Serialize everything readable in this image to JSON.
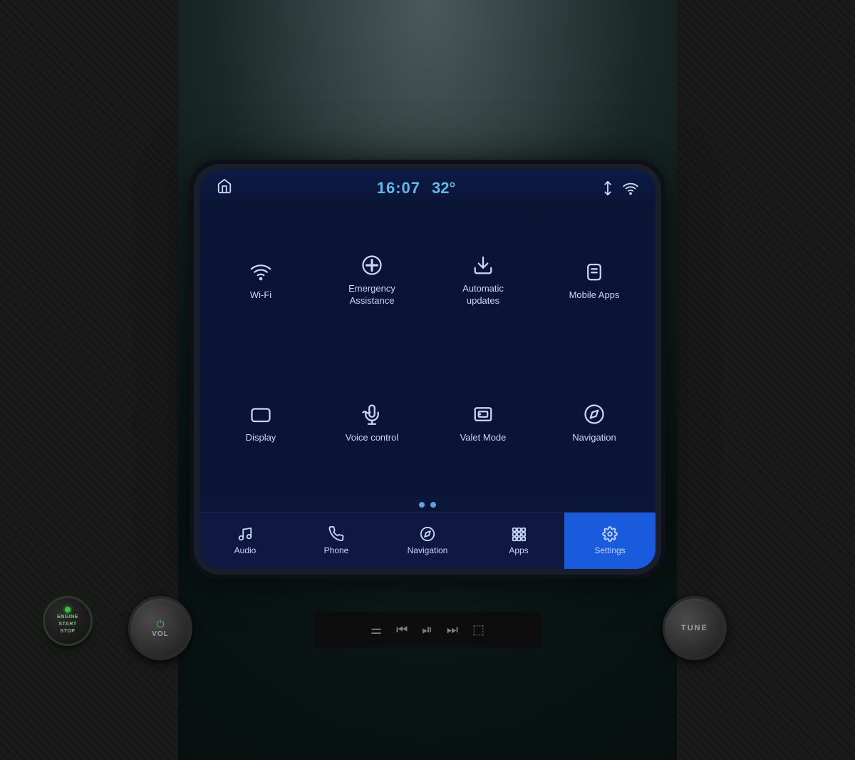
{
  "header": {
    "home_icon": "⌂",
    "time": "16:07",
    "temp": "32°",
    "signal_icon": "↕",
    "wifi_icon": "wifi"
  },
  "grid": {
    "items": [
      {
        "id": "wifi",
        "label": "Wi-Fi",
        "icon": "wifi"
      },
      {
        "id": "emergency",
        "label": "Emergency\nAssistance",
        "icon": "cross"
      },
      {
        "id": "updates",
        "label": "Automatic\nupdates",
        "icon": "download"
      },
      {
        "id": "mobile",
        "label": "Mobile Apps",
        "icon": "link"
      },
      {
        "id": "display",
        "label": "Display",
        "icon": "display"
      },
      {
        "id": "voice",
        "label": "Voice control",
        "icon": "voice"
      },
      {
        "id": "valet",
        "label": "Valet Mode",
        "icon": "valet"
      },
      {
        "id": "navigation",
        "label": "Navigation",
        "icon": "nav"
      }
    ]
  },
  "page_dots": [
    {
      "active": true
    },
    {
      "active": true
    }
  ],
  "bottom_nav": {
    "items": [
      {
        "id": "audio",
        "label": "Audio",
        "icon": "music",
        "active": false
      },
      {
        "id": "phone",
        "label": "Phone",
        "icon": "phone",
        "active": false
      },
      {
        "id": "navigation",
        "label": "Navigation",
        "icon": "nav",
        "active": false
      },
      {
        "id": "apps",
        "label": "Apps",
        "icon": "apps",
        "active": false
      },
      {
        "id": "settings",
        "label": "Settings",
        "icon": "gear",
        "active": true
      }
    ]
  },
  "physical": {
    "vol_label": "VOL",
    "tune_label": "TUNE",
    "engine_line1": "ENGINE",
    "engine_line2": "START",
    "engine_line3": "STOP"
  },
  "colors": {
    "accent_blue": "#60b8e8",
    "screen_bg": "#0a1535",
    "active_nav": "#1a5adc",
    "icon_color": "#c8d8f8"
  }
}
